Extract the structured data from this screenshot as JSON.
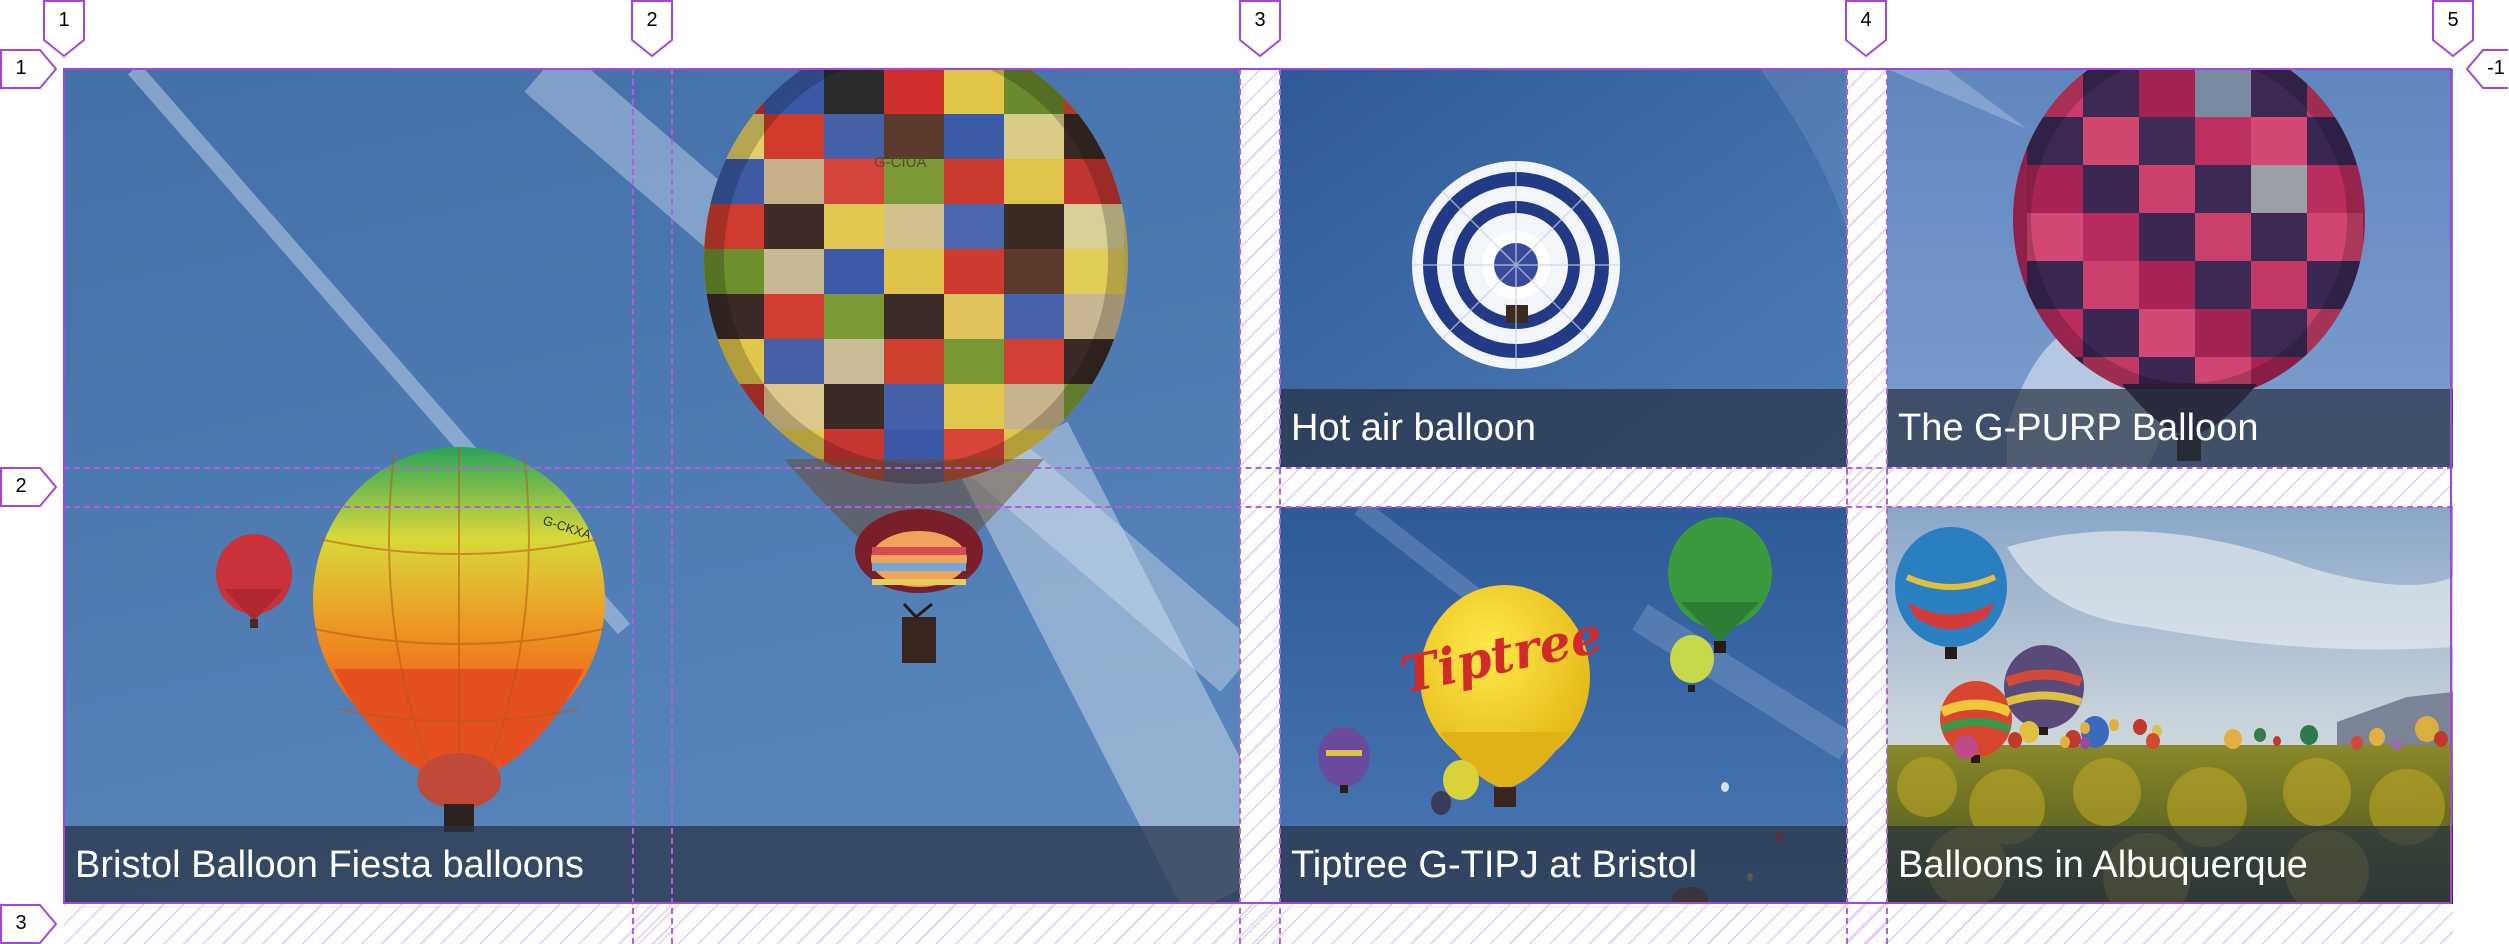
{
  "grid": {
    "column_lines": [
      "1",
      "2",
      "3",
      "4",
      "5"
    ],
    "row_lines_start": [
      "1",
      "2",
      "3"
    ],
    "row_lines_end": [
      "-1"
    ]
  },
  "tiles": [
    {
      "caption": "Bristol Balloon Fiesta balloons",
      "balloon_text_1": "G-CIUA",
      "balloon_text_2": "G-CKXA"
    },
    {
      "caption": "Hot air balloon"
    },
    {
      "caption": "The G-PURP Balloon"
    },
    {
      "caption": "Tiptree G-TIPJ at Bristol",
      "balloon_text": "Tiptree"
    },
    {
      "caption": "Balloons in Albuquerque"
    }
  ],
  "colors": {
    "grid_accent": "#a447d8",
    "caption_overlay": "rgba(40,50,66,0.72)",
    "sky_blue": "#4c78b0"
  }
}
